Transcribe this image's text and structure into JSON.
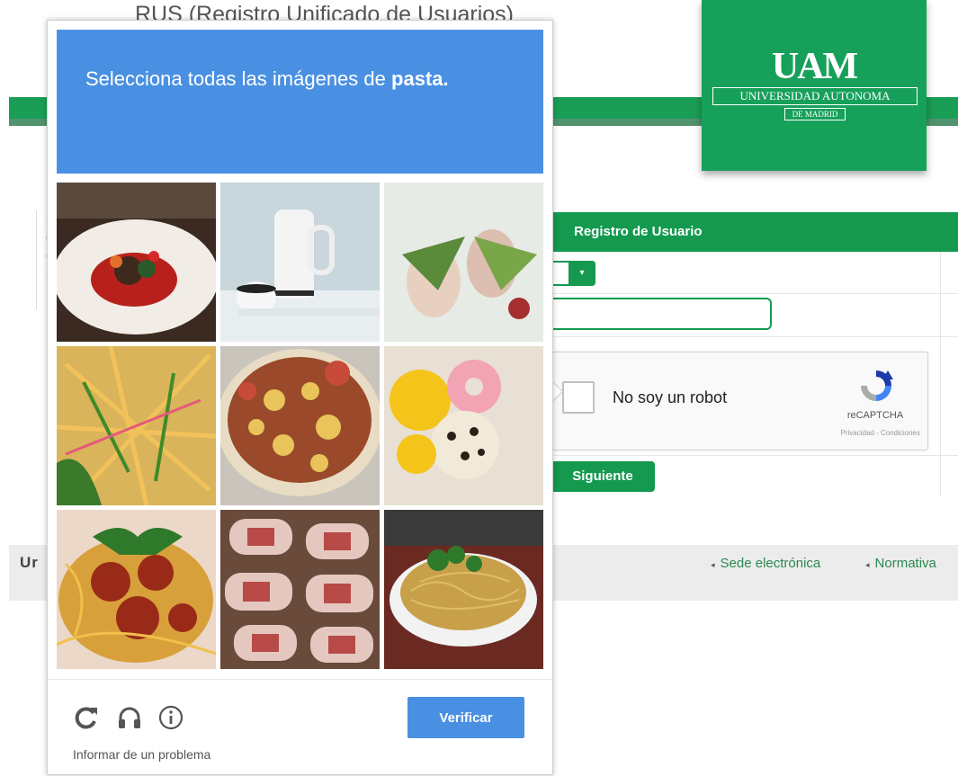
{
  "page": {
    "title": "RUS (Registro Unificado de Usuarios)",
    "logo": {
      "mark": "UAM",
      "name": "UNIVERSIDAD AUTONOMA",
      "sub": "DE MADRID"
    },
    "left_stub_letters": [
      "R",
      "C",
      "C",
      "S"
    ],
    "panel": {
      "header": "Registro de Usuario",
      "select_arrow": "▾",
      "recaptcha": {
        "label": "No soy un robot",
        "brand": "reCAPTCHA",
        "links": "Privacidad - Condiciones"
      },
      "next_button": "Siguiente"
    },
    "footer": {
      "text": "Ur",
      "links": [
        "Sede electrónica",
        "Normativa"
      ]
    }
  },
  "captcha": {
    "prompt_prefix": "Selecciona todas las imágenes de",
    "prompt_keyword": "pasta.",
    "tiles": [
      "plated-dish",
      "teapot",
      "rolls",
      "pasta-salad",
      "pizza",
      "donuts",
      "spaghetti",
      "meat-rolls",
      "noodles"
    ],
    "verify_label": "Verificar",
    "report_label": "Informar de un problema",
    "icons": [
      "reload-icon",
      "audio-icon",
      "info-icon"
    ]
  },
  "colors": {
    "green": "#14994f",
    "blue": "#4a90e2"
  }
}
